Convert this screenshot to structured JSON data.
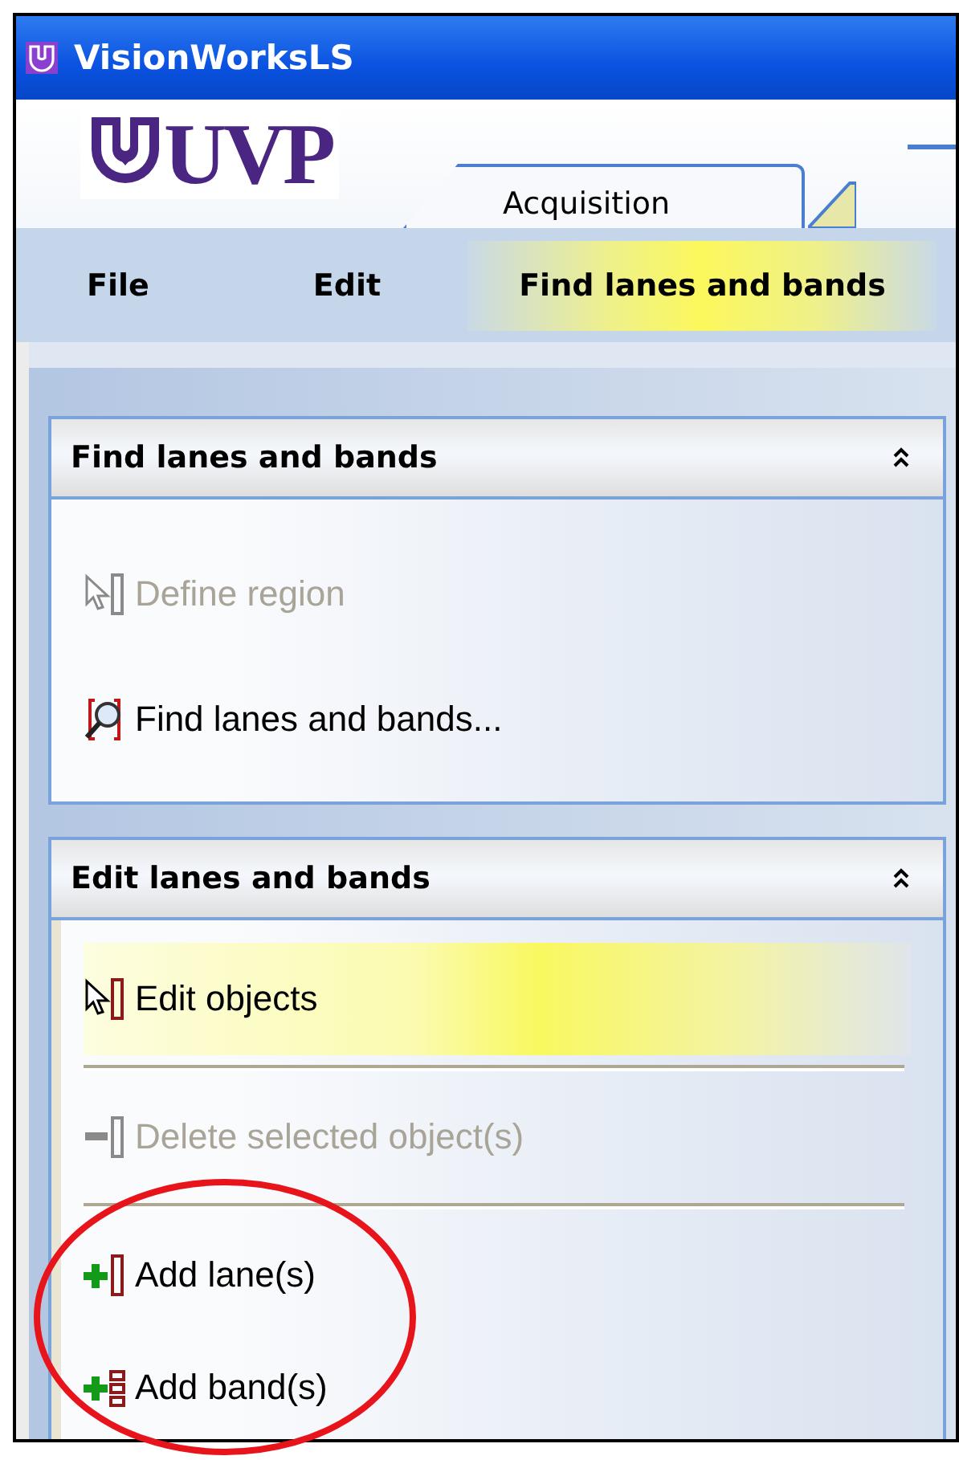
{
  "window": {
    "title": "VisionWorksLS"
  },
  "logo": {
    "text": "UVP"
  },
  "tabs": [
    {
      "label": "Acquisition",
      "selected": false
    }
  ],
  "menu": [
    {
      "label": "File",
      "selected": false
    },
    {
      "label": "Edit",
      "selected": false
    },
    {
      "label": "Find lanes and bands",
      "selected": true
    }
  ],
  "panels": [
    {
      "title": "Find lanes and bands",
      "expanded": true,
      "items": [
        {
          "kind": "define-region",
          "label": "Define region",
          "disabled": true,
          "selected": false,
          "divider": false
        },
        {
          "kind": "find",
          "label": "Find lanes and bands...",
          "disabled": false,
          "selected": false,
          "divider": false
        }
      ]
    },
    {
      "title": "Edit lanes and bands",
      "expanded": true,
      "items": [
        {
          "kind": "edit",
          "label": "Edit objects",
          "disabled": false,
          "selected": true,
          "divider": true
        },
        {
          "kind": "delete",
          "label": "Delete selected object(s)",
          "disabled": true,
          "selected": false,
          "divider": true
        },
        {
          "kind": "add-lane",
          "label": "Add lane(s)",
          "disabled": false,
          "selected": false,
          "divider": false
        },
        {
          "kind": "add-band",
          "label": "Add band(s)",
          "disabled": false,
          "selected": false,
          "divider": false
        }
      ]
    }
  ]
}
